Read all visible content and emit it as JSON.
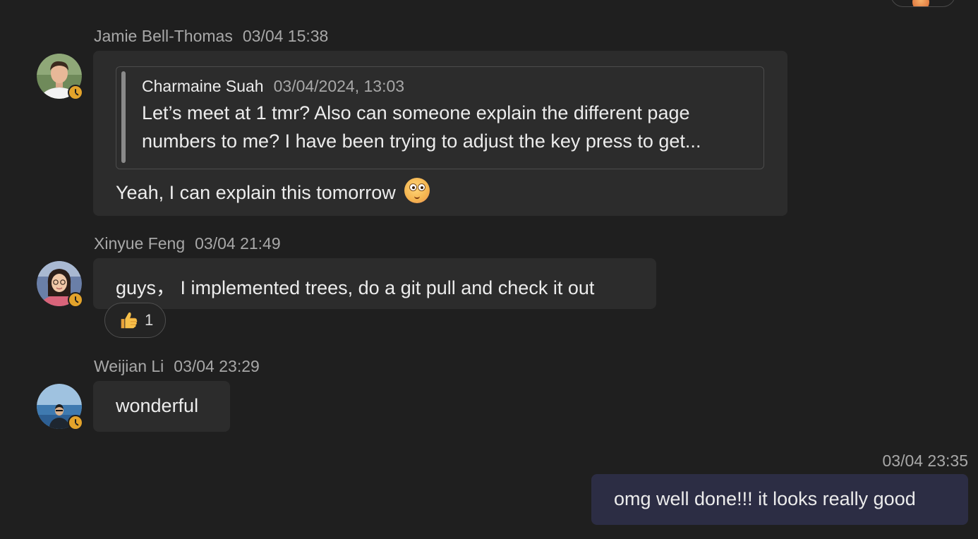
{
  "top_reaction": {
    "emoji": "reaction-emoji"
  },
  "messages": [
    {
      "sender": "Jamie Bell-Thomas",
      "time": "03/04 15:38",
      "avatar": "avatar-jamie",
      "presence": "away-clock",
      "quote": {
        "author": "Charmaine Suah",
        "time": "03/04/2024, 13:03",
        "lines": [
          "Let’s meet at 1 tmr? Also can someone explain the different page",
          "numbers to me? I have been trying to adjust the key press to get..."
        ]
      },
      "text": "Yeah, I can explain this tomorrow",
      "emoji": "eyes-wide-smile-emoji"
    },
    {
      "sender": "Xinyue Feng",
      "time": "03/04 21:49",
      "avatar": "avatar-xinyue",
      "presence": "away-clock",
      "text": "guys， I implemented trees, do a git pull and check it out",
      "reactions": [
        {
          "emoji": "thumbs-up",
          "count": "1"
        }
      ]
    },
    {
      "sender": "Weijian Li",
      "time": "03/04 23:29",
      "avatar": "avatar-weijian",
      "presence": "away-clock",
      "text": "wonderful"
    },
    {
      "own": true,
      "time": "03/04 23:35",
      "text": "omg well done!!! it looks really good"
    }
  ],
  "colors": {
    "background": "#1f1f1f",
    "bubble": "#2c2c2c",
    "own_bubble": "#2c2d44",
    "presence_away": "#e3a32b",
    "meta_text": "#a8a8a8"
  }
}
